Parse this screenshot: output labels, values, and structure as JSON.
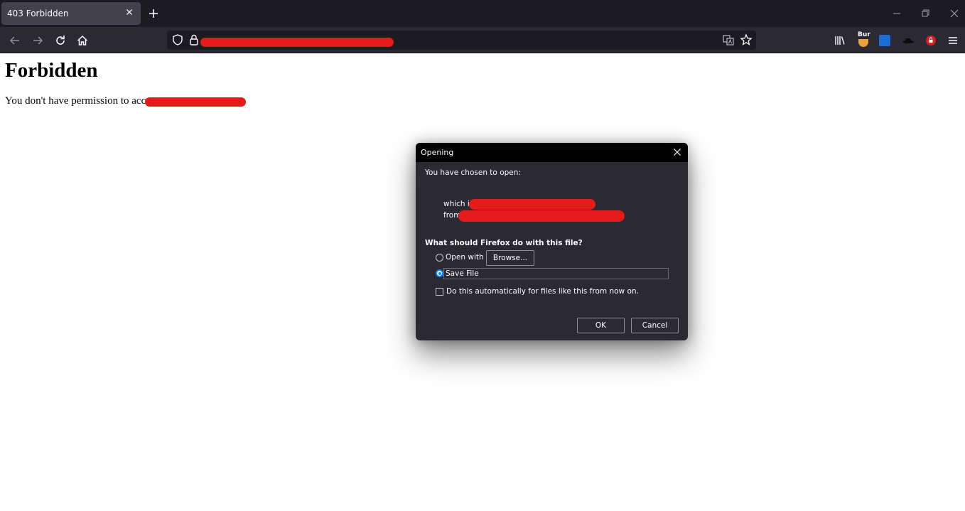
{
  "browser": {
    "tab_title": "403 Forbidden",
    "toolbar_extension_text": "Bur"
  },
  "page": {
    "heading": "Forbidden",
    "message_prefix": "You don't have permission to acces"
  },
  "dialog": {
    "title": "Opening",
    "chosen_text": "You have chosen to open:",
    "which_is_label": "which is:",
    "from_label": "from",
    "question": "What should Firefox do with this file?",
    "open_with_label": "Open with",
    "browse_label": "Browse...",
    "save_file_label": "Save File",
    "auto_label": "Do this automatically for files like this from now on.",
    "ok_label": "OK",
    "cancel_label": "Cancel",
    "selected_option": "save_file",
    "auto_checked": false
  },
  "colors": {
    "redaction": "#e51b1b",
    "accent": "#0a84ff",
    "chrome_dark": "#1c1b22"
  }
}
